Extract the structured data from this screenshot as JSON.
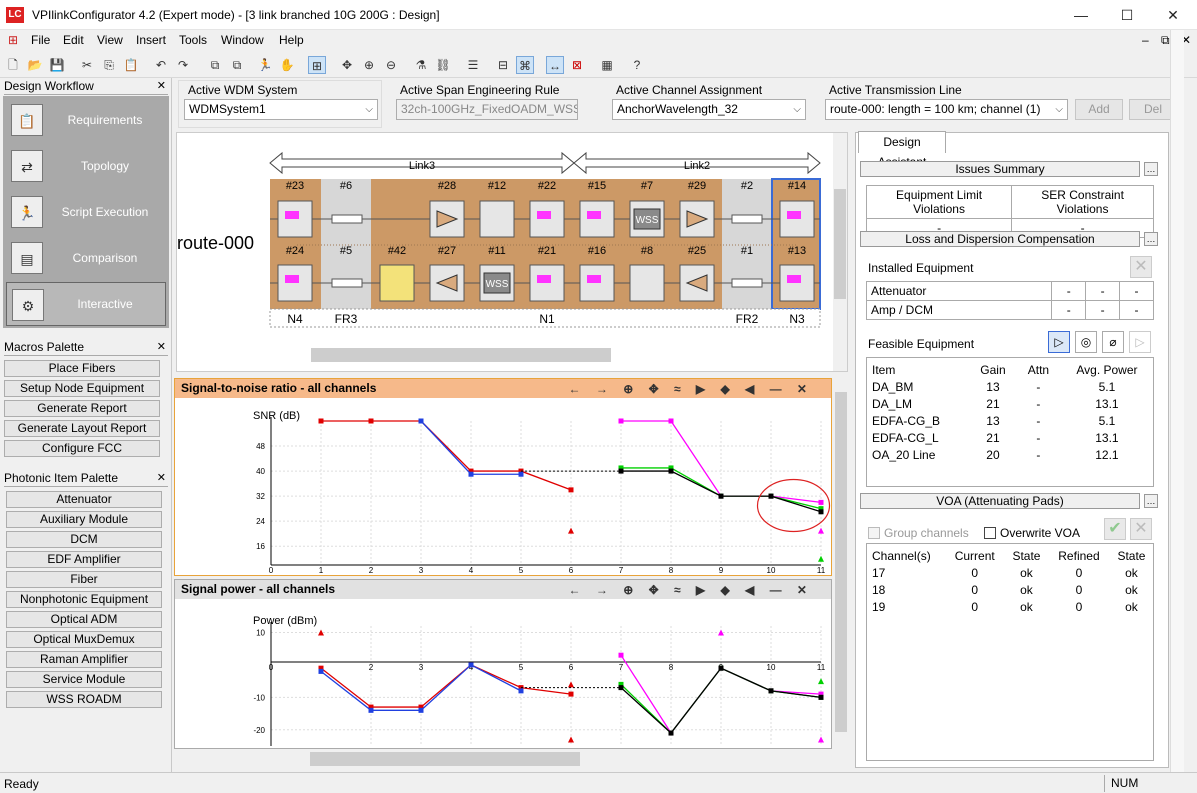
{
  "window": {
    "logo": "LC",
    "title": "VPIlinkConfigurator 4.2 (Expert mode) - [3 link branched 10G 200G : Design]"
  },
  "menu": [
    "File",
    "Edit",
    "View",
    "Insert",
    "Tools",
    "Window",
    "Help"
  ],
  "design_workflow": {
    "title": "Design Workflow",
    "items": [
      {
        "label": "Requirements",
        "icon": "clipboard-icon"
      },
      {
        "label": "Topology",
        "icon": "topology-icon"
      },
      {
        "label": "Script Execution",
        "icon": "runner-icon"
      },
      {
        "label": "Comparison",
        "icon": "compare-icon"
      },
      {
        "label": "Interactive",
        "icon": "interactive-icon"
      }
    ]
  },
  "macros_palette": {
    "title": "Macros Palette",
    "items": [
      "Place Fibers",
      "Setup Node Equipment",
      "Generate Report",
      "Generate Layout Report",
      "Configure FCC"
    ]
  },
  "photonic_palette": {
    "title": "Photonic Item Palette",
    "items": [
      "Attenuator",
      "Auxiliary Module",
      "DCM",
      "EDF Amplifier",
      "Fiber",
      "Nonphotonic Equipment",
      "Optical ADM",
      "Optical MuxDemux",
      "Raman Amplifier",
      "Service Module",
      "WSS ROADM"
    ]
  },
  "selectors": {
    "wdm": {
      "label": "Active WDM System",
      "value": "WDMSystem1"
    },
    "span": {
      "label": "Active Span Engineering Rule",
      "value": "32ch-100GHz_FixedOADM_WSS_m"
    },
    "channel": {
      "label": "Active Channel Assignment",
      "value": "AnchorWavelength_32"
    },
    "line": {
      "label": "Active Transmission Line",
      "value": "route-000: length = 100 km; channel (1)"
    },
    "add": "Add",
    "del": "Del"
  },
  "topology": {
    "route": "route-000",
    "link3": "Link3",
    "link2": "Link2",
    "top_row": [
      "#23",
      "#6",
      "#28",
      "#12",
      "#22",
      "#15",
      "#7",
      "#29",
      "#2",
      "#14"
    ],
    "bottom_row": [
      "#24",
      "#5",
      "#42",
      "#27",
      "#11",
      "#21",
      "#16",
      "#8",
      "#25",
      "#1",
      "#13"
    ],
    "wss_label": "WSS",
    "nodes": [
      "N4",
      "FR3",
      "N1",
      "FR2",
      "N3"
    ]
  },
  "snr_chart": {
    "title": "Signal-to-noise ratio - all channels",
    "chart_data": {
      "type": "line",
      "ylabel": "SNR (dB)",
      "xlim": [
        0,
        11
      ],
      "ylim": [
        10,
        56
      ],
      "x_ticks": [
        0,
        1,
        2,
        3,
        4,
        5,
        6,
        7,
        8,
        9,
        10,
        11
      ],
      "y_ticks": [
        16,
        24,
        32,
        40,
        48
      ],
      "series": [
        {
          "color": "#e00000",
          "x": [
            1,
            2,
            3,
            4,
            5,
            6
          ],
          "y": [
            56,
            56,
            56,
            40,
            40,
            34
          ]
        },
        {
          "color": "#2040e0",
          "x": [
            3,
            4,
            5
          ],
          "y": [
            56,
            39,
            39
          ]
        },
        {
          "color": "#ff00ff",
          "x": [
            7,
            8,
            9,
            10,
            11
          ],
          "y": [
            56,
            56,
            32,
            32,
            30
          ]
        },
        {
          "color": "#00d000",
          "x": [
            7,
            8,
            9,
            10,
            11
          ],
          "y": [
            41,
            41,
            32,
            32,
            28
          ]
        },
        {
          "color": "#000000",
          "x": [
            7,
            8,
            9,
            10,
            11
          ],
          "y": [
            40,
            40,
            32,
            32,
            27
          ]
        }
      ],
      "red_markers": [
        [
          6,
          21
        ]
      ],
      "magenta_markers": [
        [
          11,
          21
        ]
      ],
      "green_markers": [
        [
          11,
          12
        ]
      ]
    }
  },
  "power_chart": {
    "title": "Signal power - all channels",
    "chart_data": {
      "type": "line",
      "ylabel": "Power (dBm)",
      "xlim": [
        0,
        11
      ],
      "ylim": [
        -25,
        12
      ],
      "x_ticks": [
        0,
        2,
        3,
        4,
        5,
        6,
        7,
        8,
        9,
        10,
        11
      ],
      "y_ticks": [
        10,
        -10,
        -20
      ],
      "series": [
        {
          "color": "#e00000",
          "x": [
            1,
            2,
            3,
            4,
            5,
            6
          ],
          "y": [
            -1,
            -13,
            -13,
            0,
            -7,
            -9
          ]
        },
        {
          "color": "#2040e0",
          "x": [
            1,
            2,
            3,
            4,
            5
          ],
          "y": [
            -2,
            -14,
            -14,
            0,
            -8
          ]
        },
        {
          "color": "#ff00ff",
          "x": [
            7,
            8,
            9,
            10,
            11
          ],
          "y": [
            3,
            -21,
            -1,
            -8,
            -9
          ]
        },
        {
          "color": "#00d000",
          "x": [
            7,
            8,
            9,
            10,
            11
          ],
          "y": [
            -6,
            -21,
            -1,
            -8,
            -10
          ]
        },
        {
          "color": "#000000",
          "x": [
            7,
            8,
            9,
            10,
            11
          ],
          "y": [
            -7,
            -21,
            -1,
            -8,
            -10
          ]
        }
      ],
      "red_markers": [
        [
          1,
          10
        ],
        [
          6,
          -6
        ],
        [
          6,
          -23
        ]
      ],
      "magenta_markers": [
        [
          9,
          10
        ],
        [
          11,
          -23
        ]
      ],
      "green_markers": [
        [
          11,
          -5
        ]
      ]
    }
  },
  "design_assistant": {
    "tab": "Design Assistant",
    "issues": "Issues Summary",
    "issues_cols": [
      "Equipment Limit Violations",
      "SER Constraint Violations"
    ],
    "issues_vals": [
      "-",
      "-"
    ],
    "loss": "Loss and Dispersion Compensation",
    "installed": "Installed Equipment",
    "installed_rows": [
      [
        "Attenuator",
        "-",
        "-",
        "-"
      ],
      [
        "Amp / DCM",
        "-",
        "-",
        "-"
      ]
    ],
    "feasible": "Feasible Equipment",
    "feasible_header": [
      "Item",
      "Gain",
      "Attn",
      "Avg. Power"
    ],
    "feasible_rows": [
      [
        "DA_BM",
        "13",
        "-",
        "5.1"
      ],
      [
        "DA_LM",
        "21",
        "-",
        "13.1"
      ],
      [
        "EDFA-CG_B",
        "13",
        "-",
        "5.1"
      ],
      [
        "EDFA-CG_L",
        "21",
        "-",
        "13.1"
      ],
      [
        "OA_20 Line",
        "20",
        "-",
        "12.1"
      ]
    ],
    "voa": "VOA (Attenuating Pads)",
    "group_channels": "Group channels",
    "overwrite": "Overwrite VOA",
    "voa_header": [
      "Channel(s)",
      "Current",
      "State",
      "Refined",
      "State"
    ],
    "voa_rows": [
      [
        "17",
        "0",
        "ok",
        "0",
        "ok"
      ],
      [
        "18",
        "0",
        "ok",
        "0",
        "ok"
      ],
      [
        "19",
        "0",
        "ok",
        "0",
        "ok"
      ]
    ]
  },
  "status": {
    "left": "Ready",
    "right": "NUM"
  }
}
